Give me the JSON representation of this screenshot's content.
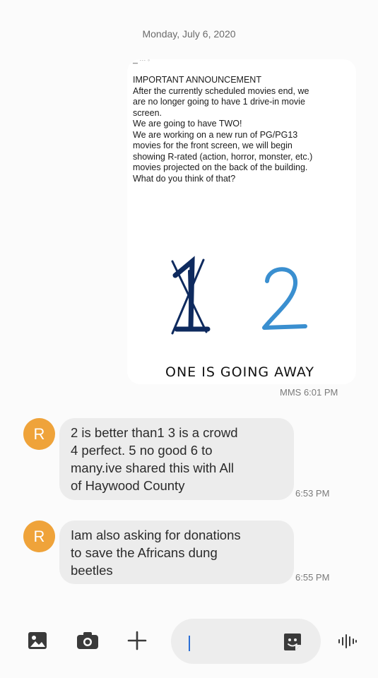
{
  "thread": {
    "date_header": "Monday, July 6, 2020"
  },
  "mms": {
    "avatar_strip": "▁ ··· ◦",
    "announcement_lines": [
      "IMPORTANT ANNOUNCEMENT",
      "After the currently scheduled movies end, we",
      "are no longer going to have 1 drive-in movie",
      "screen.",
      "We are going to have TWO!",
      "We are working on a new run of PG/PG13",
      "movies for the front screen, we will begin",
      "showing R-rated (action, horror, monster, etc.)",
      "movies projected on the back of the building.",
      "What do you think of that?"
    ],
    "caption": "ONE IS GOING AWAY",
    "meta": "MMS 6:01 PM"
  },
  "messages": [
    {
      "avatar_letter": "R",
      "lines": [
        "2 is better  than1  3 is a crowd",
        "4 perfect. 5 no good 6 to",
        "many.ive shared this with  All",
        "of Haywood  County"
      ],
      "time": "6:53 PM"
    },
    {
      "avatar_letter": "R",
      "lines": [
        "Iam also asking  for donations",
        "to save the Africans dung",
        "beetles"
      ],
      "time": "6:55 PM"
    }
  ],
  "composer": {
    "icons": [
      "gallery-icon",
      "camera-icon",
      "plus-icon",
      "sticker-icon",
      "voice-icon"
    ],
    "input_value": ""
  },
  "colors": {
    "avatar": "#efa33a",
    "bubble": "#ececec",
    "crossed_one": "#0e2a5e",
    "two": "#3a8fd0"
  }
}
